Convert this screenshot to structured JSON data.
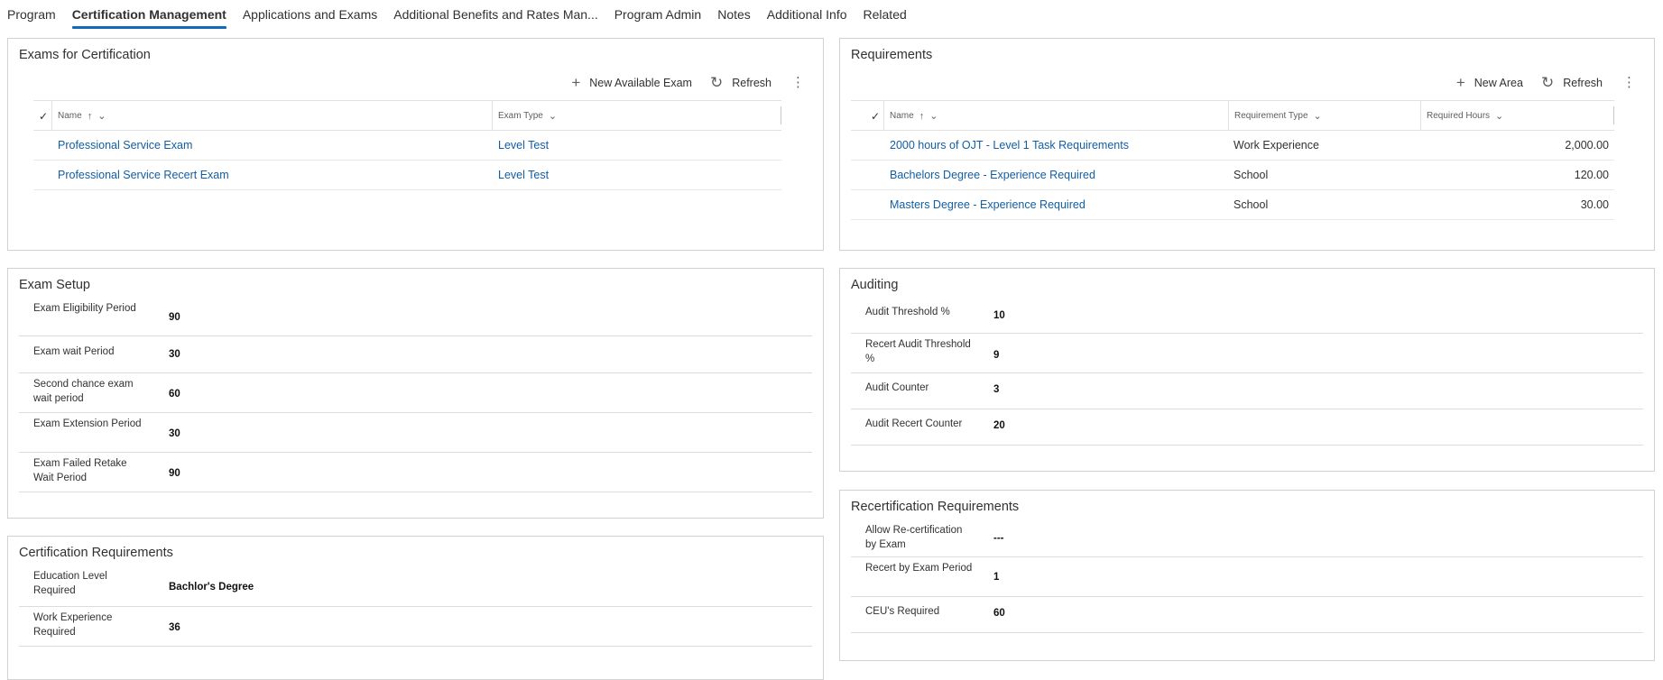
{
  "tabs": [
    {
      "label": "Program"
    },
    {
      "label": "Certification Management"
    },
    {
      "label": "Applications and Exams"
    },
    {
      "label": "Additional Benefits and Rates Man..."
    },
    {
      "label": "Program Admin"
    },
    {
      "label": "Notes"
    },
    {
      "label": "Additional Info"
    },
    {
      "label": "Related"
    }
  ],
  "exams": {
    "title": "Exams for Certification",
    "new_label": "New Available Exam",
    "refresh_label": "Refresh",
    "columns": [
      "Name",
      "Exam Type"
    ],
    "rows": [
      {
        "name": "Professional Service Exam",
        "type": "Level Test"
      },
      {
        "name": "Professional Service Recert Exam",
        "type": "Level Test"
      }
    ]
  },
  "requirements": {
    "title": "Requirements",
    "new_label": "New Area",
    "refresh_label": "Refresh",
    "columns": [
      "Name",
      "Requirement Type",
      "Required Hours"
    ],
    "rows": [
      {
        "name": "2000 hours of OJT - Level 1 Task Requirements",
        "type": "Work Experience",
        "hours": "2,000.00"
      },
      {
        "name": "Bachelors Degree - Experience Required",
        "type": "School",
        "hours": "120.00"
      },
      {
        "name": "Masters Degree - Experience Required",
        "type": "School",
        "hours": "30.00"
      }
    ]
  },
  "exam_setup": {
    "title": "Exam Setup",
    "fields": [
      {
        "label": "Exam Eligibility Period",
        "value": "90"
      },
      {
        "label": "Exam wait Period",
        "value": "30"
      },
      {
        "label": "Second chance exam wait period",
        "value": "60"
      },
      {
        "label": "Exam Extension Period",
        "value": "30"
      },
      {
        "label": "Exam Failed Retake Wait Period",
        "value": "90"
      }
    ]
  },
  "auditing": {
    "title": "Auditing",
    "fields": [
      {
        "label": "Audit Threshold %",
        "value": "10"
      },
      {
        "label": "Recert Audit Threshold %",
        "value": "9"
      },
      {
        "label": "Audit Counter",
        "value": "3"
      },
      {
        "label": "Audit Recert Counter",
        "value": "20"
      }
    ]
  },
  "cert_requirements": {
    "title": "Certification Requirements",
    "fields": [
      {
        "label": "Education Level Required",
        "value": "Bachlor's Degree"
      },
      {
        "label": "Work Experience Required",
        "value": "36"
      }
    ]
  },
  "recert_requirements": {
    "title": "Recertification Requirements",
    "fields": [
      {
        "label": "Allow Re-certification by Exam",
        "value": "---"
      },
      {
        "label": "Recert by Exam Period",
        "value": "1"
      },
      {
        "label": "CEU's Required",
        "value": "60"
      }
    ]
  }
}
